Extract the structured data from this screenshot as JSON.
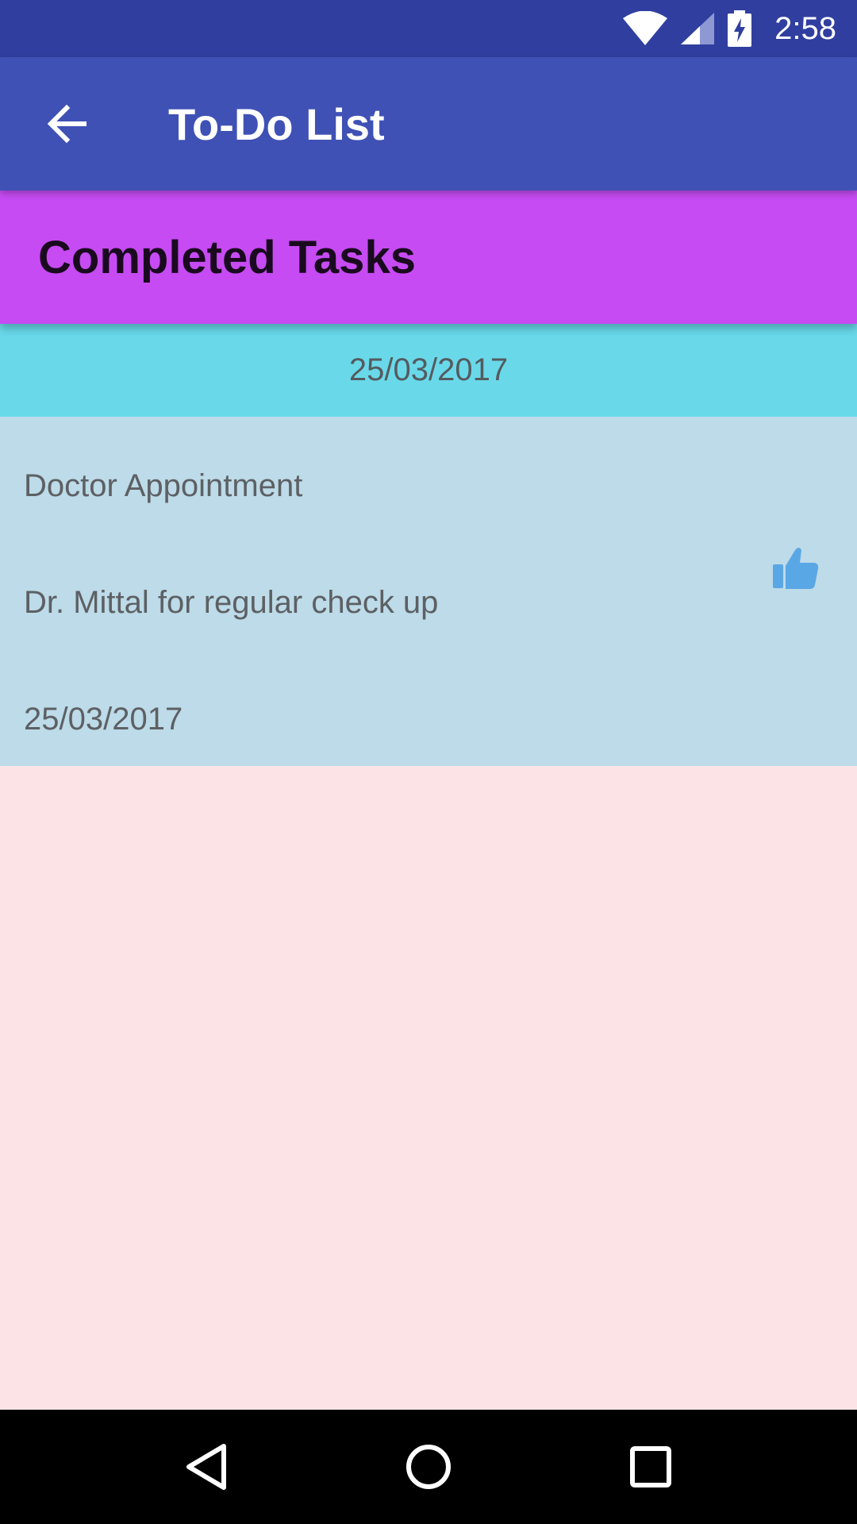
{
  "status_bar": {
    "time": "2:58"
  },
  "app_bar": {
    "title": "To-Do List",
    "back_icon": "arrow-back-icon"
  },
  "section": {
    "title": "Completed Tasks"
  },
  "date_group": {
    "date": "25/03/2017"
  },
  "task": {
    "title": "Doctor Appointment",
    "description": "Dr. Mittal for regular check up",
    "date": "25/03/2017",
    "icon": "thumbs-up-icon"
  },
  "nav_bar": {
    "back": "nav-back-icon",
    "home": "nav-home-icon",
    "recents": "nav-recents-icon"
  },
  "colors": {
    "status_bar": "#303f9f",
    "app_bar": "#3f51b5",
    "section_header": "#c64bf3",
    "date_header": "#69d9ea",
    "task_card": "#bddbe8",
    "background": "#fce4e6",
    "thumb": "#5aa7e6"
  }
}
